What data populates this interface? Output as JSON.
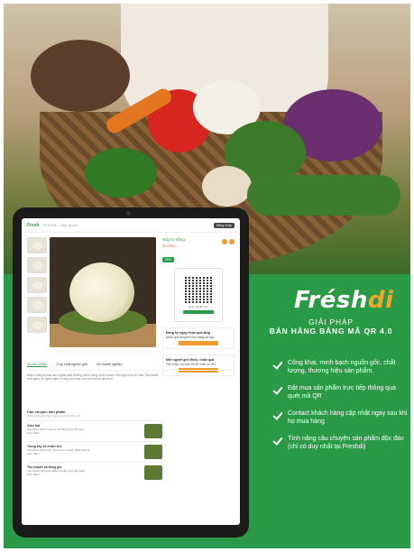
{
  "tablet": {
    "topbar": {
      "logo": "Fresh",
      "breadcrumb": "Tổ Fresh > Sạp rau củ",
      "button": "Đăng nhập"
    },
    "product": {
      "title": "Súp lơ trắng",
      "price": "50.000đ",
      "badge": "Sỉ/lẻ",
      "qr_caption": "Quét mã để xem",
      "card1_title": "Đăng ký ngay nhận quà tặng",
      "card1_text": "Nhận quà tặng khi mua hàng tại sạp.",
      "card2_title": "Mời người giới thiệu, nhận quà",
      "card2_text": "Giới thiệu cho bạn bè để nhận ưu đãi."
    },
    "tabs": [
      "Về sản phẩm",
      "Truy xuất nguồn gốc",
      "Về doanh nghiệp"
    ],
    "description": "Súp lơ trắng là loại rau củ giàu dinh dưỡng, được trồng và thu hoạch theo quy trình an toàn. Sản phẩm tươi ngon, có nguồn gốc rõ ràng, phù hợp cho mọi bữa ăn gia đình.",
    "stories_heading": "Câu chuyện sản phẩm",
    "stories_sub": "Các bước xuất hiện trong quá trình sản xuất",
    "stories": [
      {
        "title": "Gieo hạt",
        "text": "Hạt giống được chọn lọc kỹ càng trước khi gieo.",
        "more": "Xem thêm"
      },
      {
        "title": "Trồng cây và chăm sóc",
        "text": "Cây được chăm sóc, tưới nước và bón phân định kỳ.",
        "more": "Xem thêm"
      },
      {
        "title": "Thu hoạch và đóng gói",
        "text": "Thu hoạch đúng thời điểm và đóng gói cẩn thận.",
        "more": "Xem thêm"
      }
    ]
  },
  "brand": {
    "name_a": "Frésh",
    "name_b": "di"
  },
  "headline": {
    "line1": "GIẢI PHÁP",
    "line2": "BÁN HÀNG BẰNG MÃ QR 4.0"
  },
  "features": [
    "Công khai, minh bạch nguồn gốc, chất lượng, thương hiệu sản phẩm.",
    "Đặt mua sản phẩm trực tiếp thông qua quét mã QR",
    "Contact khách hàng cập nhật ngay sau khi họ mua hàng",
    "Tính năng câu chuyện sản phẩm độc đáo (chỉ có duy nhất tại Freshdi)"
  ]
}
